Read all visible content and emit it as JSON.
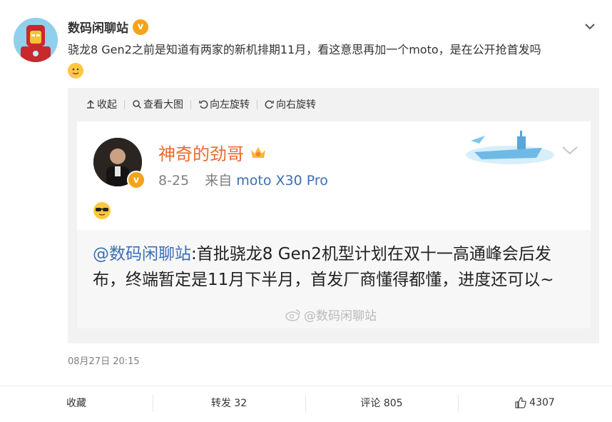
{
  "post": {
    "author": "数码闲聊站",
    "verified_badge": "v",
    "text": "骁龙8 Gen2之前是知道有两家的新机排期11月，看这意思再加一个moto，是在公开抢首发吗",
    "timestamp": "08月27日 20:15"
  },
  "toolbar": {
    "collapse": "收起",
    "view_large": "查看大图",
    "rotate_left": "向左旋转",
    "rotate_right": "向右旋转"
  },
  "image": {
    "name": "神奇的劲哥",
    "date": "8-25",
    "from_label": "来自",
    "source": "moto X30 Pro",
    "mention": "@数码闲聊站",
    "quote_text": ":首批骁龙8 Gen2机型计划在双十一高通峰会后发布，终端暂定是11月下半月，首发厂商懂得都懂，进度还可以~",
    "watermark": "@数码闲聊站"
  },
  "actions": {
    "favorite": "收藏",
    "repost": "转发 32",
    "comment": "评论 805",
    "like": "4307"
  },
  "colors": {
    "accent_link": "#3b6fb4",
    "name_orange": "#e86a2c",
    "badge": "#f7a21b"
  }
}
